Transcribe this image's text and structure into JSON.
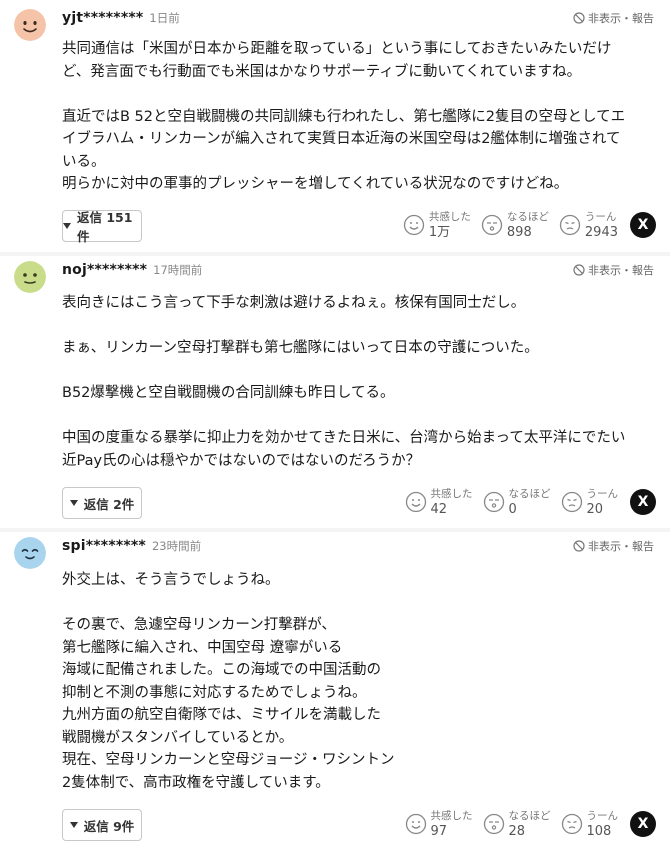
{
  "report_label": "非表示・報告",
  "reaction_labels": {
    "empathy": "共感した",
    "insightful": "なるほど",
    "hmm": "うーん"
  },
  "share_icon_text": "X",
  "comments": [
    {
      "username": "yjt********",
      "time": "1日前",
      "avatar_color": "#f5c4a8",
      "paragraphs": [
        "共同通信は「米国が日本から距離を取っている」という事にしておきたいみたいだけ\nど、発言面でも行動面でも米国はかなりサポーティブに動いてくれていますね。",
        "直近ではB 52と空自戦闘機の共同訓練も行われたし、第七艦隊に2隻目の空母としてエ\nイブラハム・リンカーンが編入されて実質日本近海の米国空母は2艦体制に増強されて\nいる。\n明らかに対中の軍事的プレッシャーを増してくれている状況なのですけどね。"
      ],
      "reply_label": "返信 151件",
      "empathy_count": "1万",
      "insightful_count": "898",
      "hmm_count": "2943"
    },
    {
      "username": "noj********",
      "time": "17時間前",
      "avatar_color": "#c8dc8a",
      "paragraphs": [
        "表向きにはこう言って下手な刺激は避けるよねぇ。核保有国同士だし。",
        "まぁ、リンカーン空母打撃群も第七艦隊にはいって日本の守護についた。",
        "B52爆撃機と空自戦闘機の合同訓練も昨日してる。",
        "中国の度重なる暴挙に抑止力を効かせてきた日米に、台湾から始まって太平洋にでたい\n近Pay氏の心は穏やかではないのではないのだろうか？"
      ],
      "reply_label": "返信 2件",
      "empathy_count": "42",
      "insightful_count": "0",
      "hmm_count": "20"
    },
    {
      "username": "spi********",
      "time": "23時間前",
      "avatar_color": "#a8d4ee",
      "paragraphs": [
        "外交上は、そう言うでしょうね。",
        "その裏で、急遽空母リンカーン打撃群が、\n第七艦隊に編入され、中国空母 遼寧がいる\n海域に配備されました。この海域での中国活動の\n抑制と不測の事態に対応するためでしょうね。\n九州方面の航空自衛隊では、ミサイルを満載した\n戦闘機がスタンバイしているとか。\n現在、空母リンカーンと空母ジョージ・ワシントン\n2隻体制で、高市政権を守護しています。"
      ],
      "reply_label": "返信 9件",
      "empathy_count": "97",
      "insightful_count": "28",
      "hmm_count": "108"
    }
  ]
}
